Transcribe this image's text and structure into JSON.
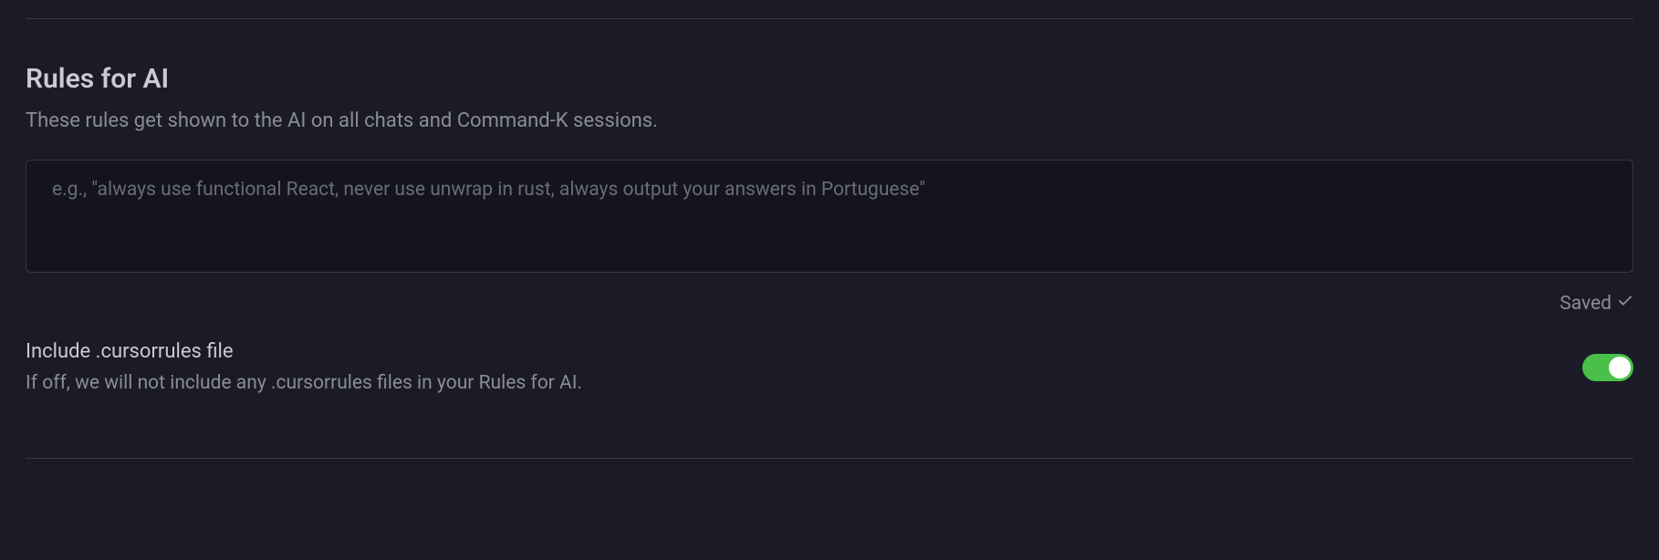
{
  "section": {
    "title": "Rules for AI",
    "description": "These rules get shown to the AI on all chats and Command-K sessions."
  },
  "textarea": {
    "value": "",
    "placeholder": "e.g., \"always use functional React, never use unwrap in rust, always output your answers in Portuguese\""
  },
  "status": {
    "saved_label": "Saved"
  },
  "setting": {
    "label": "Include .cursorrules file",
    "description": "If off, we will not include any .cursorrules files in your Rules for AI.",
    "toggle_on": true
  },
  "colors": {
    "toggle_active": "#4ac04a"
  }
}
